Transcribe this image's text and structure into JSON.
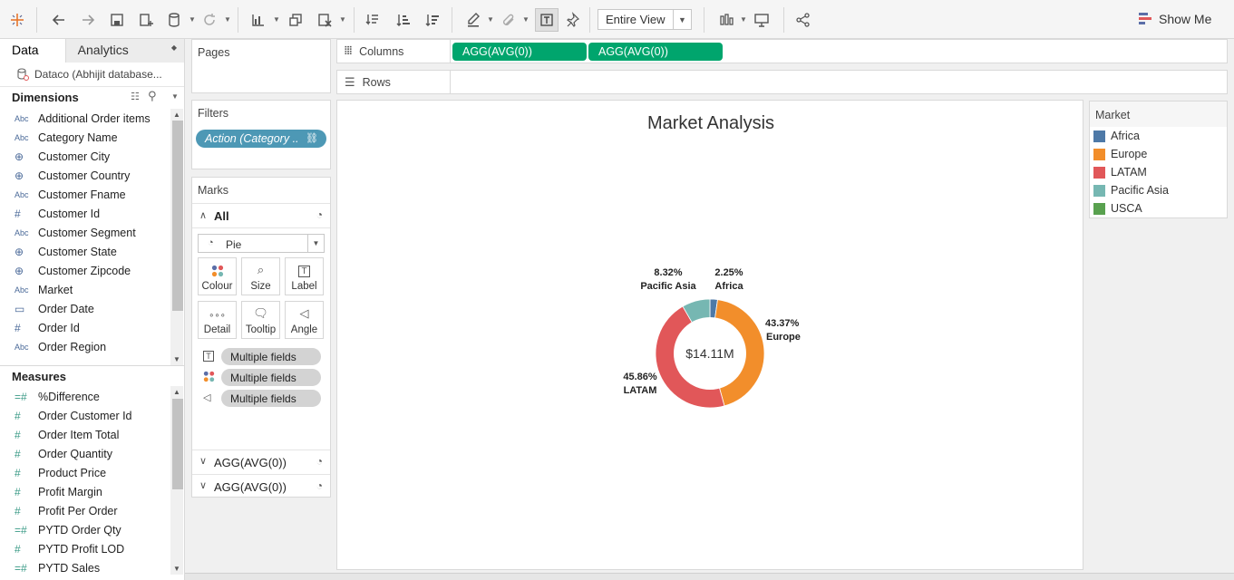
{
  "toolbar": {
    "view_mode": "Entire View",
    "show_me": "Show Me"
  },
  "data_pane": {
    "tabs": [
      "Data",
      "Analytics"
    ],
    "datasource": "Dataco (Abhijit database...",
    "dimensions_label": "Dimensions",
    "dimensions": [
      {
        "type": "Abc",
        "name": "Additional Order items"
      },
      {
        "type": "Abc",
        "name": "Category Name"
      },
      {
        "type": "geo",
        "name": "Customer City"
      },
      {
        "type": "geo",
        "name": "Customer Country"
      },
      {
        "type": "Abc",
        "name": "Customer Fname"
      },
      {
        "type": "#",
        "name": "Customer Id"
      },
      {
        "type": "Abc",
        "name": "Customer Segment"
      },
      {
        "type": "geo",
        "name": "Customer State"
      },
      {
        "type": "geo",
        "name": "Customer Zipcode"
      },
      {
        "type": "Abc",
        "name": "Market"
      },
      {
        "type": "date",
        "name": "Order Date"
      },
      {
        "type": "#",
        "name": "Order Id"
      },
      {
        "type": "Abc",
        "name": "Order Region"
      }
    ],
    "measures_label": "Measures",
    "measures": [
      {
        "type": "=#",
        "name": "%Difference"
      },
      {
        "type": "#",
        "name": "Order Customer Id"
      },
      {
        "type": "#",
        "name": "Order Item Total"
      },
      {
        "type": "#",
        "name": "Order Quantity"
      },
      {
        "type": "#",
        "name": "Product Price"
      },
      {
        "type": "#",
        "name": "Profit Margin"
      },
      {
        "type": "#",
        "name": "Profit Per Order"
      },
      {
        "type": "=#",
        "name": "PYTD Order Qty"
      },
      {
        "type": "#",
        "name": "PYTD Profit LOD"
      },
      {
        "type": "=#",
        "name": "PYTD Sales"
      }
    ]
  },
  "pages": {
    "title": "Pages"
  },
  "filters": {
    "title": "Filters",
    "pill": "Action (Category .."
  },
  "marks": {
    "title": "Marks",
    "all_label": "All",
    "mark_type": "Pie",
    "buttons": [
      "Colour",
      "Size",
      "Label",
      "Detail",
      "Tooltip",
      "Angle"
    ],
    "pills": [
      "Multiple fields",
      "Multiple fields",
      "Multiple fields"
    ],
    "sub_cards": [
      "AGG(AVG(0))",
      "AGG(AVG(0))"
    ]
  },
  "shelves": {
    "columns_label": "Columns",
    "columns_pills": [
      "AGG(AVG(0))",
      "AGG(AVG(0))"
    ],
    "rows_label": "Rows"
  },
  "chart_data": {
    "type": "pie",
    "title": "Market Analysis",
    "center_label": "$14.11M",
    "categories": [
      "Africa",
      "Europe",
      "LATAM",
      "Pacific Asia"
    ],
    "values": [
      2.25,
      43.37,
      45.86,
      8.32
    ],
    "labels": [
      "2.25%",
      "43.37%",
      "45.86%",
      "8.32%"
    ],
    "colors": [
      "#4e79a7",
      "#f28e2b",
      "#e15759",
      "#76b7b2"
    ],
    "donut": true,
    "legend_position": "right"
  },
  "legend": {
    "title": "Market",
    "items": [
      {
        "name": "Africa",
        "color": "#4e79a7"
      },
      {
        "name": "Europe",
        "color": "#f28e2b"
      },
      {
        "name": "LATAM",
        "color": "#e15759"
      },
      {
        "name": "Pacific Asia",
        "color": "#76b7b2"
      },
      {
        "name": "USCA",
        "color": "#59a14f"
      }
    ]
  }
}
